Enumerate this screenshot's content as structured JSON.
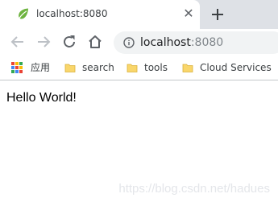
{
  "tab": {
    "title": "localhost:8080",
    "close_glyph": "✕",
    "favicon": "leaf-icon"
  },
  "toolbar": {
    "back_icon": "arrow-left-icon",
    "forward_icon": "arrow-right-icon",
    "reload_icon": "reload-icon",
    "home_icon": "home-icon",
    "info_icon": "info-icon",
    "url_host": "localhost",
    "url_port": ":8080"
  },
  "bookmarks": {
    "items": [
      {
        "label": "应用",
        "icon": "apps-grid-icon"
      },
      {
        "label": "search",
        "icon": "folder-icon"
      },
      {
        "label": "tools",
        "icon": "folder-icon"
      },
      {
        "label": "Cloud Services",
        "icon": "folder-icon"
      }
    ]
  },
  "page": {
    "body_text": "Hello World!",
    "watermark": "https://blog.csdn.net/hadues"
  },
  "colors": {
    "tabstrip": "#dee1e6",
    "omnibox": "#f1f3f4",
    "folder": "#f9d66b",
    "favicon": "#6db33f"
  }
}
